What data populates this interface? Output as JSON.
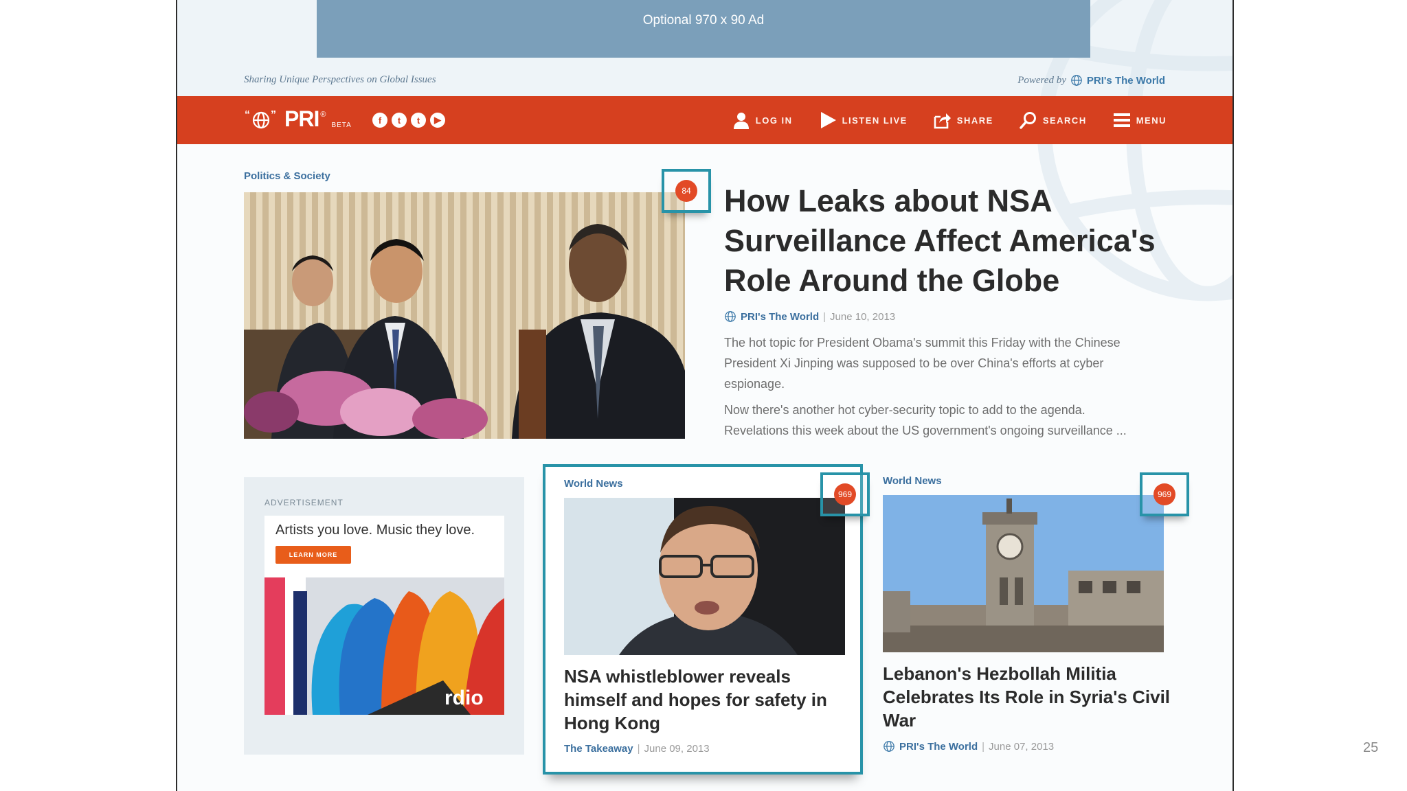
{
  "ad_banner": {
    "text": "Optional 970 x 90 Ad"
  },
  "tagline": "Sharing Unique Perspectives on Global Issues",
  "powered_by": {
    "prefix": "Powered by",
    "name": "PRI's The World"
  },
  "navbar": {
    "logo": "PRI",
    "logo_sup": "®",
    "logo_beta": "BETA",
    "social": [
      "f",
      "t",
      "t",
      "▶"
    ],
    "items": [
      {
        "label": "LOG IN",
        "icon": "user-icon"
      },
      {
        "label": "LISTEN LIVE",
        "icon": "play-icon"
      },
      {
        "label": "SHARE",
        "icon": "share-icon"
      },
      {
        "label": "SEARCH",
        "icon": "search-icon"
      },
      {
        "label": "MENU",
        "icon": "menu-icon"
      }
    ]
  },
  "featured": {
    "category": "Politics & Society",
    "comment_count": "84",
    "title": "How Leaks about NSA Surveillance Affect America's Role Around the Globe",
    "source": "PRI's The World",
    "date": "June 10, 2013",
    "summary_1": "The hot topic for President Obama's summit this Friday with the Chinese President Xi Jinping was supposed to be over China's efforts at cyber espionage.",
    "summary_2": "Now there's another hot cyber-security topic to add to the agenda. Revelations this week about the US government's ongoing surveillance ..."
  },
  "advertisement": {
    "label": "ADVERTISEMENT",
    "tagline": "Artists you love. Music they love.",
    "button": "LEARN MORE",
    "brand": "rdio"
  },
  "stories": [
    {
      "category": "World News",
      "comment_count": "969",
      "title": "NSA whistleblower reveals himself and hopes for safety in Hong Kong",
      "source": "The Takeaway",
      "date": "June 09, 2013"
    },
    {
      "category": "World News",
      "comment_count": "969",
      "title": "Lebanon's Hezbollah Militia Celebrates Its Role in Syria's Civil War",
      "source": "PRI's The World",
      "date": "June 07, 2013"
    }
  ],
  "slide_number": "25",
  "colors": {
    "brand_red": "#d6401f",
    "accent_teal": "#2893a8",
    "link_blue": "#3b6f9e",
    "ad_blue": "#7b9fba"
  }
}
